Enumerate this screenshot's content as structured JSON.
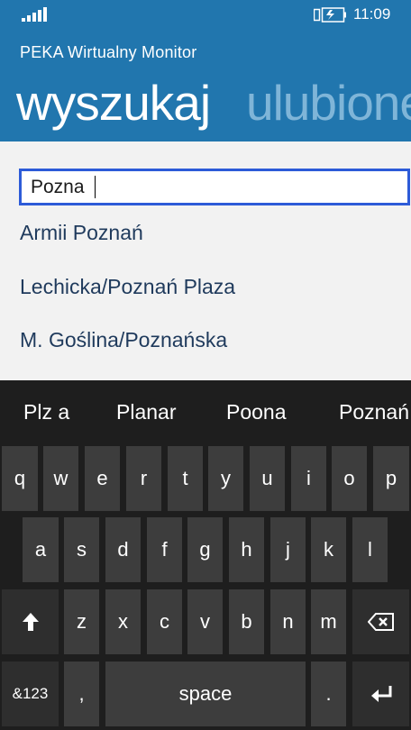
{
  "status_bar": {
    "signal_icon": "signal-bars-icon",
    "battery_icon": "battery-charging-icon",
    "time": "11:09"
  },
  "header": {
    "app_title": "PEKA Wirtualny Monitor",
    "pivot_active": "wyszukaj",
    "pivot_next": "ulubione"
  },
  "search": {
    "value": "Pozna"
  },
  "results": [
    "Armii Poznań",
    "Lechicka/Poznań Plaza",
    "M. Goślina/Poznańska"
  ],
  "keyboard": {
    "suggestions": [
      "Plz a",
      "Planar",
      "Poona",
      "Poznań"
    ],
    "row1": [
      "q",
      "w",
      "e",
      "r",
      "t",
      "y",
      "u",
      "i",
      "o",
      "p"
    ],
    "row2": [
      "a",
      "s",
      "d",
      "f",
      "g",
      "h",
      "j",
      "k",
      "l"
    ],
    "row3": [
      "z",
      "x",
      "c",
      "v",
      "b",
      "n",
      "m"
    ],
    "shift_icon": "shift-arrow-icon",
    "backspace_icon": "backspace-icon",
    "symbols_label": "&123",
    "comma_label": ",",
    "space_label": "space",
    "period_label": ".",
    "enter_icon": "enter-icon",
    "colors": {
      "background": "#1e1e1e",
      "key": "#3d3d3d",
      "key_alt": "#2e2e2e",
      "accent": "#2176ae",
      "focus_border": "#2d5bd8"
    }
  }
}
